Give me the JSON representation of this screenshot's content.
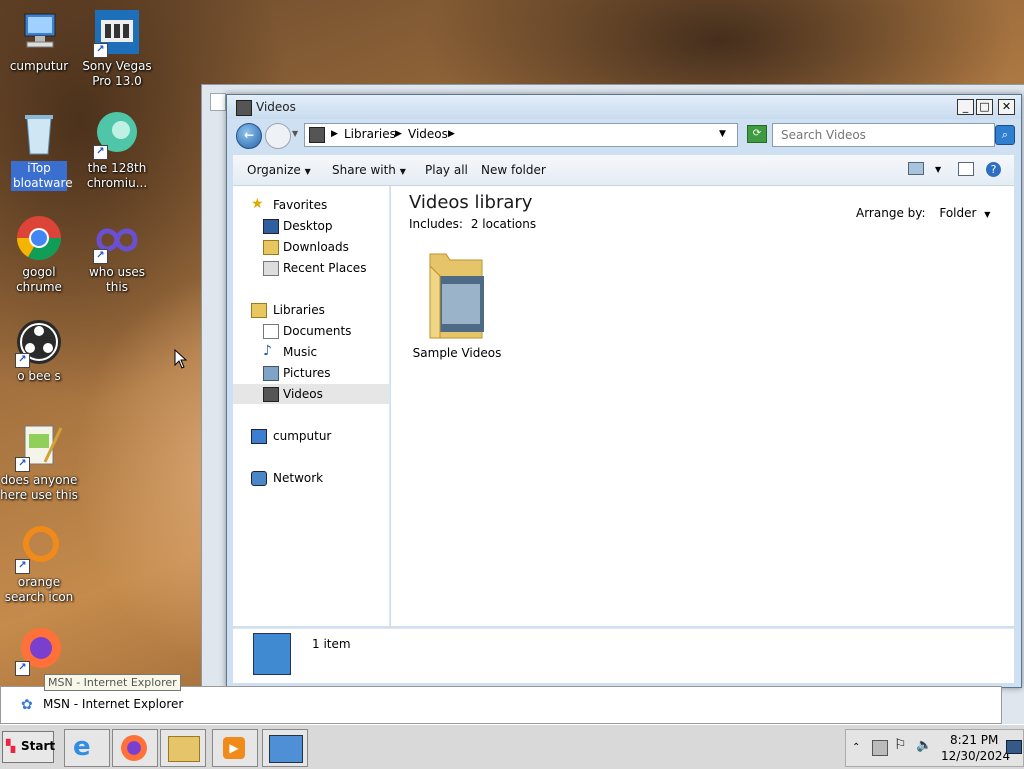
{
  "desktop": {
    "icons": [
      {
        "label": "cumputur",
        "icon": "computer-icon"
      },
      {
        "label": "Sony Vegas Pro 13.0",
        "icon": "film-icon"
      },
      {
        "label": "iTop bloatware",
        "icon": "recycle-bin-icon"
      },
      {
        "label": "the 128th chromiu...",
        "icon": "edge-icon"
      },
      {
        "label": "gogol chrume",
        "icon": "chrome-icon"
      },
      {
        "label": "who uses this",
        "icon": "infinity-icon"
      },
      {
        "label": "o bee s",
        "icon": "obs-icon"
      },
      {
        "label": "does anyone here use this",
        "icon": "notepad-icon"
      },
      {
        "label": "orange search icon",
        "icon": "orange-circle-icon"
      },
      {
        "label": "",
        "icon": "firefox-icon"
      }
    ]
  },
  "window": {
    "title": "Videos",
    "address": {
      "root": "Libraries",
      "current": "Videos"
    },
    "search": {
      "placeholder": "Search Videos"
    },
    "toolbar": {
      "organize": "Organize",
      "share": "Share with",
      "play_all": "Play all",
      "new_folder": "New folder"
    },
    "nav": {
      "favorites": "Favorites",
      "favorites_items": [
        "Desktop",
        "Downloads",
        "Recent Places"
      ],
      "libraries": "Libraries",
      "libraries_items": [
        "Documents",
        "Music",
        "Pictures",
        "Videos"
      ],
      "computer": "cumputur",
      "network": "Network"
    },
    "content": {
      "title": "Videos library",
      "includes_label": "Includes:",
      "includes_link": "2 locations",
      "arrange_label": "Arrange by:",
      "arrange_value": "Folder",
      "folders": [
        {
          "name": "Sample Videos"
        }
      ]
    },
    "details": {
      "count": "1 item"
    }
  },
  "tooltip": "MSN - Internet Explorer",
  "ie_bar": {
    "label": "MSN - Internet Explorer"
  },
  "taskbar": {
    "start": "Start",
    "time": "8:21 PM",
    "date": "12/30/2024"
  }
}
